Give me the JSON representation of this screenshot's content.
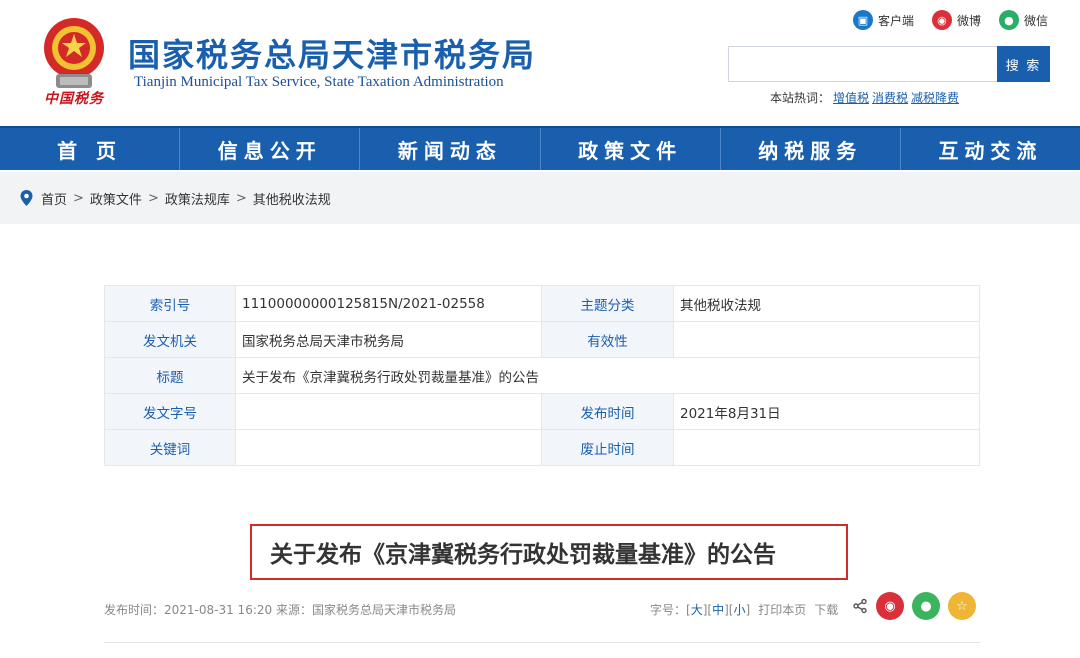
{
  "header": {
    "title": "国家税务总局天津市税务局",
    "subtitle": "Tianjin Municipal Tax Service, State Taxation Administration",
    "seal_text": "中国税务",
    "top_links": [
      {
        "label": "客户端",
        "icon": "client-icon",
        "color": "#1a78c9"
      },
      {
        "label": "微博",
        "icon": "weibo-icon",
        "color": "#d9303a"
      },
      {
        "label": "微信",
        "icon": "wechat-icon",
        "color": "#2aae67"
      }
    ],
    "search": {
      "placeholder": "",
      "button_label": "搜 索"
    },
    "hot": {
      "label": "本站热词：",
      "words": [
        "增值税",
        "消费税",
        "减税降费"
      ]
    }
  },
  "nav": {
    "items": [
      "首 页",
      "信息公开",
      "新闻动态",
      "政策文件",
      "纳税服务",
      "互动交流"
    ]
  },
  "breadcrumb": {
    "items": [
      "首页",
      "政策文件",
      "政策法规库",
      "其他税收法规"
    ],
    "separator": ">"
  },
  "meta": {
    "rows": [
      {
        "k1": "索引号",
        "v1": "11100000000125815N/2021-02558",
        "k2": "主题分类",
        "v2": "其他税收法规"
      },
      {
        "k1": "发文机关",
        "v1": "国家税务总局天津市税务局",
        "k2": "有效性",
        "v2": ""
      },
      {
        "k1": "标题",
        "v1": "关于发布《京津冀税务行政处罚裁量基准》的公告"
      },
      {
        "k1": "发文字号",
        "v1": "",
        "k2": "发布时间",
        "v2": "2021年8月31日"
      },
      {
        "k1": "关键词",
        "v1": "",
        "k2": "废止时间",
        "v2": ""
      }
    ]
  },
  "article": {
    "title": "关于发布《京津冀税务行政处罚裁量基准》的公告",
    "pubinfo": "发布时间：2021-08-31 16:20  来源：国家税务总局天津市税务局",
    "font_label": "字号：",
    "font_sizes": [
      "大",
      "中",
      "小"
    ],
    "print_label": "打印本页",
    "download_label": "下载"
  },
  "colors": {
    "brand_blue": "#1a5fae",
    "highlight_red": "#d12b2b"
  }
}
